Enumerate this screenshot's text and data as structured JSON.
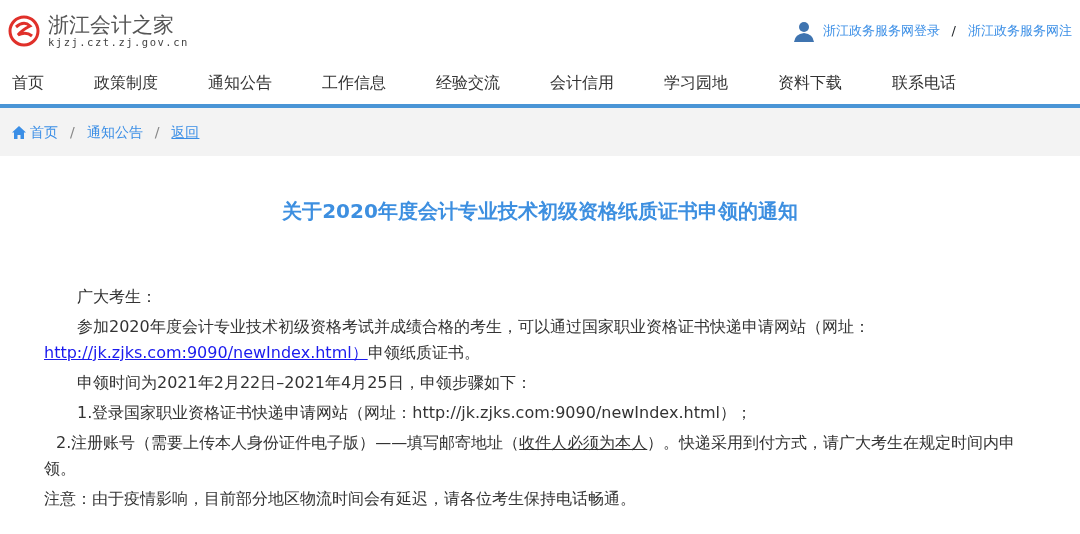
{
  "site": {
    "name": "浙江会计之家",
    "domain": "kjzj.czt.zj.gov.cn"
  },
  "account_links": {
    "separator": "/",
    "items": [
      "浙江政务服务网登录",
      "浙江政务服务网注"
    ]
  },
  "nav": [
    "首页",
    "政策制度",
    "通知公告",
    "工作信息",
    "经验交流",
    "会计信用",
    "学习园地",
    "资料下载",
    "联系电话"
  ],
  "breadcrumb": {
    "separator": "/",
    "items": [
      {
        "label": "首页",
        "kind": "home"
      },
      {
        "label": "通知公告",
        "kind": "link"
      },
      {
        "label": "返回",
        "kind": "back"
      }
    ]
  },
  "article": {
    "title": "关于2020年度会计专业技术初级资格纸质证书申领的通知",
    "paragraphs": [
      {
        "kind": "indent",
        "segments": [
          {
            "kind": "plain",
            "text": "广大考生："
          }
        ]
      },
      {
        "kind": "indent",
        "segments": [
          {
            "kind": "plain",
            "text": "参加2020年度会计专业技术初级资格考试并成绩合格的考生，可以通过国家职业资格证书快递申请网站（网址："
          },
          {
            "kind": "link",
            "text": "http://jk.zjks.com:9090/newIndex.html）"
          },
          {
            "kind": "plain",
            "text": "申领纸质证书。"
          }
        ]
      },
      {
        "kind": "indent",
        "segments": [
          {
            "kind": "plain",
            "text": "申领时间为2021年2月22日–2021年4月25日，申领步骤如下："
          }
        ]
      },
      {
        "kind": "indent",
        "segments": [
          {
            "kind": "plain",
            "text": "1.登录国家职业资格证书快递申请网站（网址：http://jk.zjks.com:9090/newIndex.html）；"
          }
        ]
      },
      {
        "kind": "half-indent",
        "segments": [
          {
            "kind": "plain",
            "text": "2.注册账号（需要上传本人身份证件电子版）——填写邮寄地址（"
          },
          {
            "kind": "underline",
            "text": "收件人必须为本人"
          },
          {
            "kind": "plain",
            "text": "）。快递采用到付方式，请广大考生在规定时间内申领。"
          }
        ]
      },
      {
        "kind": "flush",
        "segments": [
          {
            "kind": "plain",
            "text": "注意：由于疫情影响，目前部分地区物流时间会有延迟，请各位考生保持电话畅通。"
          }
        ]
      }
    ]
  }
}
